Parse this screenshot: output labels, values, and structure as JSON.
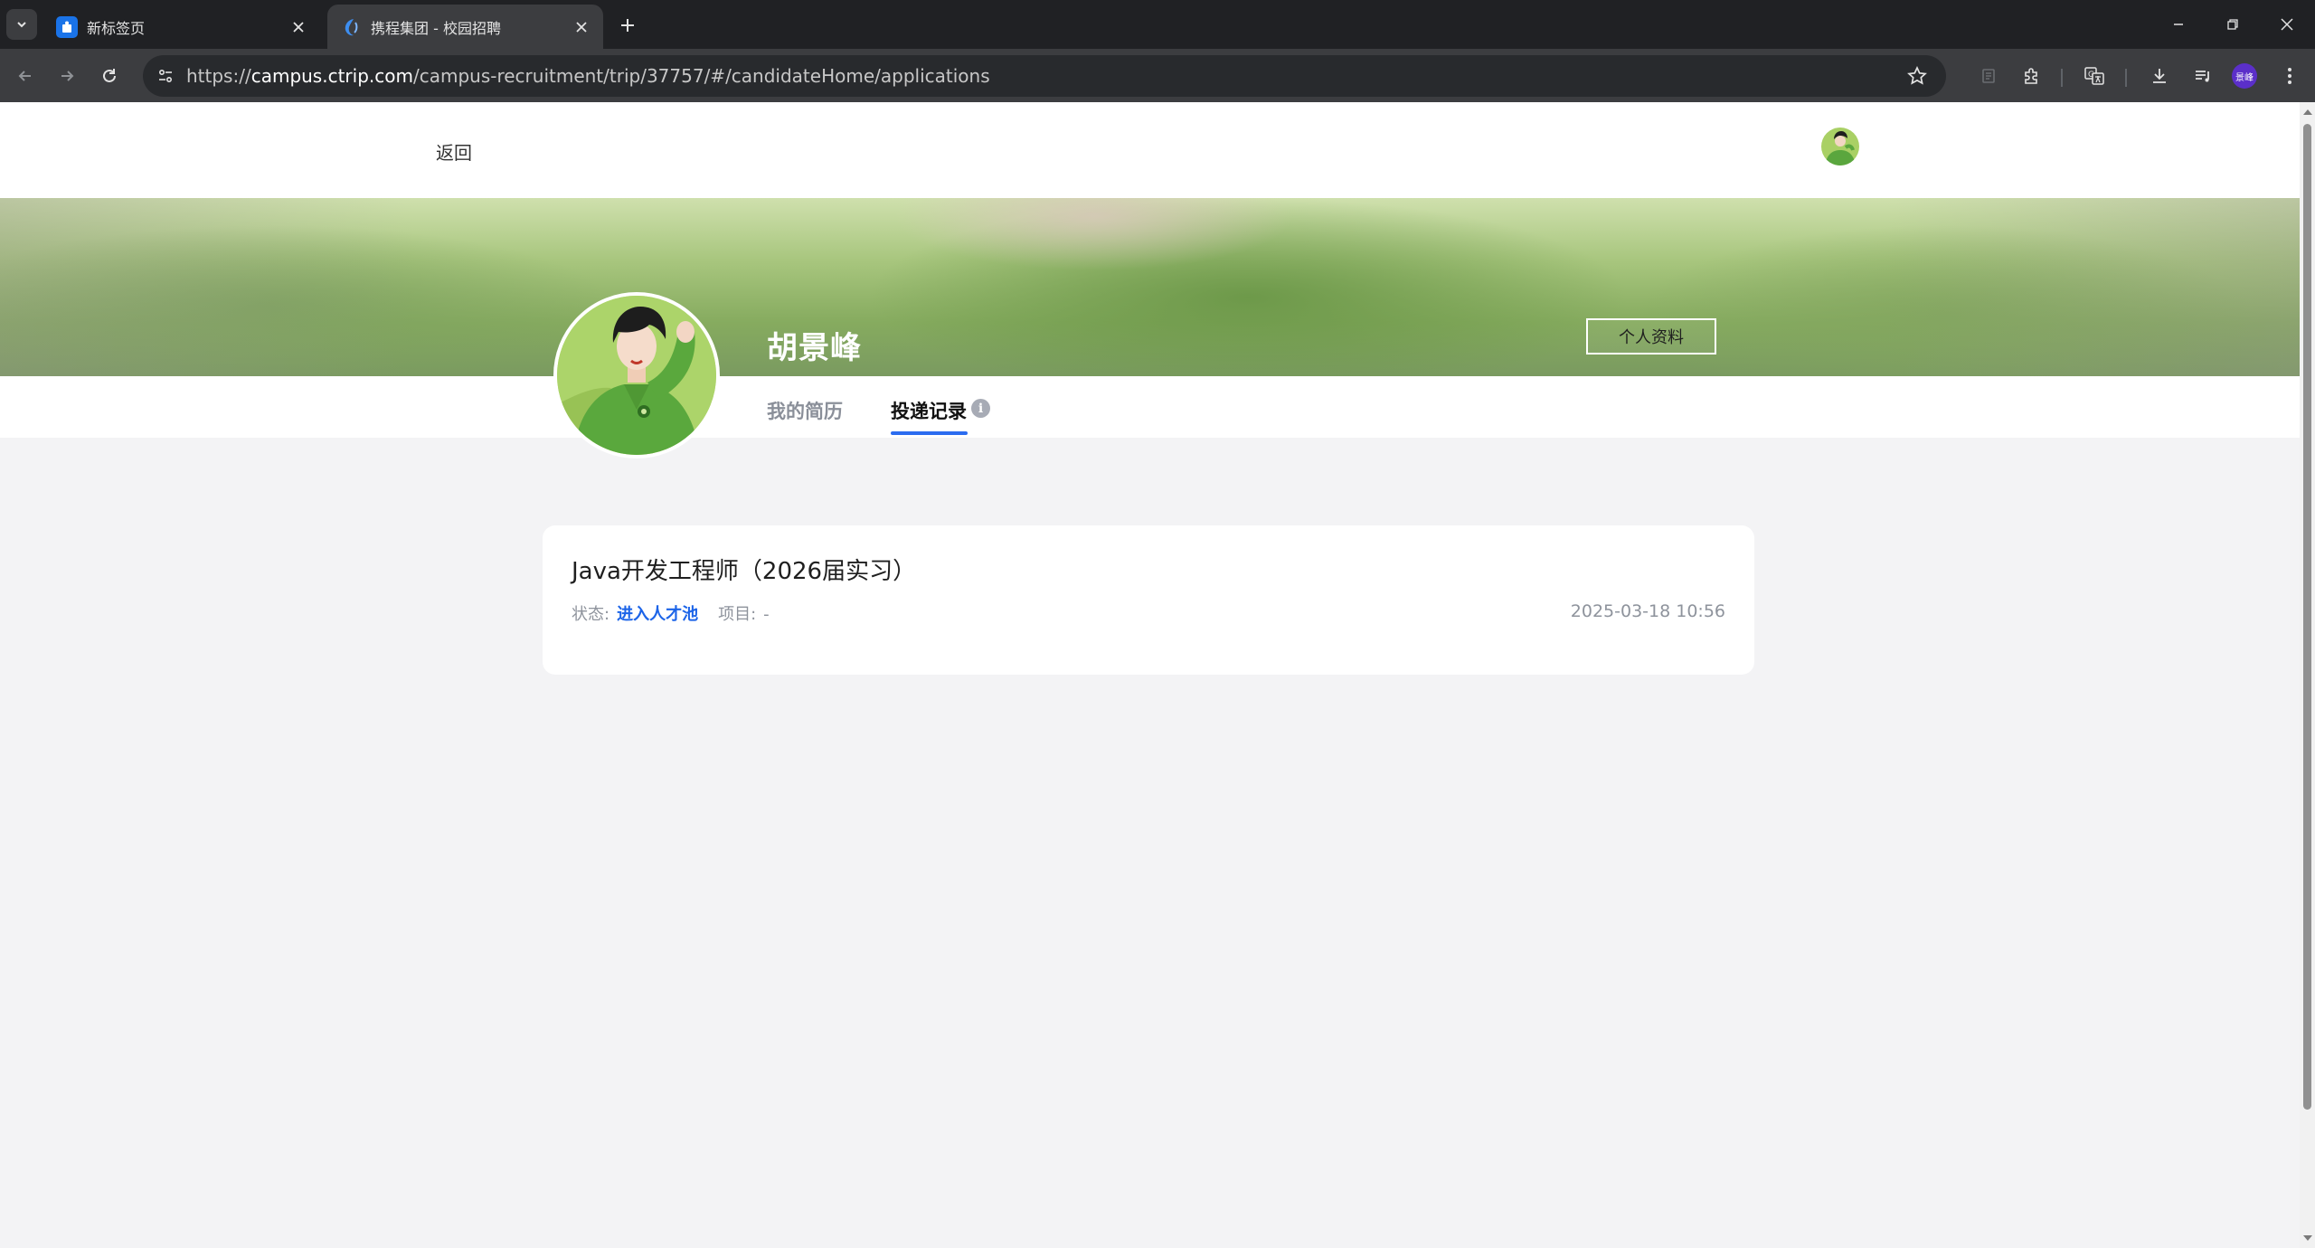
{
  "browser": {
    "tabs": [
      {
        "title": "新标签页",
        "active": false,
        "icon": "new-tab-page-icon"
      },
      {
        "title": "携程集团 - 校园招聘",
        "active": true,
        "icon": "ctrip-logo-icon"
      }
    ],
    "address": {
      "scheme": "https://",
      "host": "campus.ctrip.com",
      "path": "/campus-recruitment/trip/37757/#/candidateHome/applications"
    },
    "profile_chip": "景峰",
    "colors": {
      "frame": "#202124",
      "toolbar": "#3c3d40",
      "omnibox": "#282a2d"
    }
  },
  "header": {
    "back_label": "返回"
  },
  "profile": {
    "name": "胡景峰",
    "profile_button": "个人资料",
    "tabs": [
      {
        "label": "我的简历",
        "active": false
      },
      {
        "label": "投递记录",
        "active": true
      }
    ],
    "info_symbol": "i"
  },
  "applications": [
    {
      "job_title": "Java开发工程师（2026届实习）",
      "status_label": "状态:",
      "status_value": "进入人才池",
      "project_label": "项目:",
      "project_value": "-",
      "applied_at": "2025-03-18 10:56"
    }
  ],
  "colors": {
    "accent_blue": "#1c64e8",
    "tab_underline": "#2b6cf0",
    "page_background": "#f3f3f5",
    "banner_green": "#86ab5f"
  }
}
